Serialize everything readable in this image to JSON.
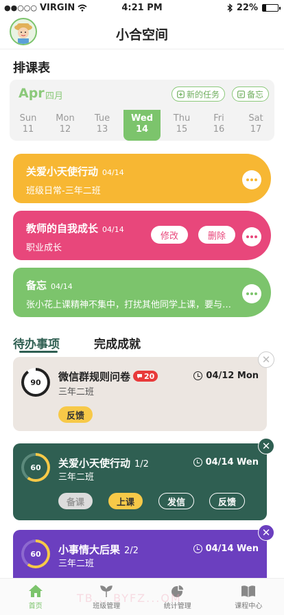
{
  "status_bar": {
    "carrier": "VIRGIN",
    "time": "4:21 PM",
    "battery": "22%",
    "battery_level": 0.22
  },
  "header": {
    "title": "小合空间",
    "avatar_icon": "avatar-icon"
  },
  "schedule": {
    "section_title": "排课表",
    "month": "Apr",
    "month_cn": "四月",
    "new_task_label": "新的任务",
    "memo_label": "备忘",
    "days": [
      {
        "name": "Sun",
        "num": "11"
      },
      {
        "name": "Mon",
        "num": "12"
      },
      {
        "name": "Tue",
        "num": "13"
      },
      {
        "name": "Wed",
        "num": "14"
      },
      {
        "name": "Thu",
        "num": "15"
      },
      {
        "name": "Fri",
        "num": "16"
      },
      {
        "name": "Sat",
        "num": "17"
      }
    ],
    "active_day_index": 3,
    "cards": [
      {
        "title": "关爱小天使行动",
        "date": "04/14",
        "subtitle": "班级日常-三年二班",
        "color": "#f7b733"
      },
      {
        "title": "教师的自我成长",
        "date": "04/14",
        "subtitle": "职业成长",
        "color": "#e8477b",
        "edit_label": "修改",
        "delete_label": "删除"
      },
      {
        "title": "备忘",
        "date": "04/14",
        "subtitle": "张小花上课精神不集中，打扰其他同学上课，要与…",
        "color": "#7cc46c"
      }
    ]
  },
  "tabs": {
    "todo": "待办事项",
    "done": "完成成就"
  },
  "todos": [
    {
      "title": "微信群规则问卷",
      "comment_count": "20",
      "class": "三年二班",
      "time": "04/12 Mon",
      "progress": "90",
      "progress_fraction": 0.9,
      "feedback_label": "反馈",
      "color": "#ece6e1"
    },
    {
      "title": "关爱小天使行动",
      "count": "1/2",
      "class": "三年二班",
      "time": "04/14 Wen",
      "progress": "60",
      "progress_fraction": 0.6,
      "buttons": [
        "备课",
        "上课",
        "发信",
        "反馈"
      ],
      "color": "#2f5f52"
    },
    {
      "title": "小事情大后果",
      "count": "2/2",
      "class": "三年二班",
      "time": "04/14 Wen",
      "progress": "60",
      "progress_fraction": 0.6,
      "color": "#6b3fbf"
    }
  ],
  "nav": [
    {
      "label": "首页",
      "icon": "home-icon"
    },
    {
      "label": "班级管理",
      "icon": "leaf-icon"
    },
    {
      "label": "统计管理",
      "icon": "pie-chart-icon"
    },
    {
      "label": "课程中心",
      "icon": "book-icon"
    }
  ],
  "watermark": "TB... BYFZ...OM"
}
